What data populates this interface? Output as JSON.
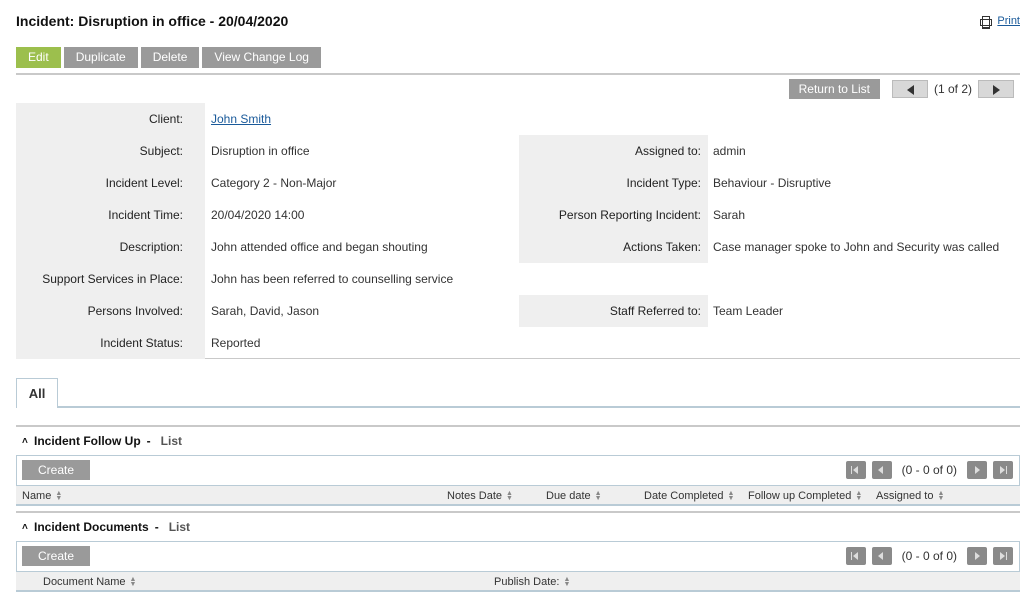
{
  "page": {
    "title": "Incident: Disruption in office - 20/04/2020",
    "print_label": "Print"
  },
  "actions": [
    "Edit",
    "Duplicate",
    "Delete",
    "View Change Log"
  ],
  "nav": {
    "return_label": "Return to List",
    "pager": "(1 of 2)"
  },
  "details": {
    "client": {
      "label": "Client:",
      "value": "John Smith"
    },
    "subject": {
      "label": "Subject:",
      "value": "Disruption in office"
    },
    "incident_level": {
      "label": "Incident Level:",
      "value": "Category 2 - Non-Major"
    },
    "incident_time": {
      "label": "Incident Time:",
      "value": "20/04/2020 14:00"
    },
    "description": {
      "label": "Description:",
      "value": "John attended office and began shouting"
    },
    "support_services": {
      "label": "Support Services in Place:",
      "value": "John has been referred to counselling service"
    },
    "persons_involved": {
      "label": "Persons Involved:",
      "value": "Sarah, David, Jason"
    },
    "incident_status": {
      "label": "Incident Status:",
      "value": "Reported"
    },
    "assigned_to": {
      "label": "Assigned to:",
      "value": "admin"
    },
    "incident_type": {
      "label": "Incident Type:",
      "value": "Behaviour - Disruptive"
    },
    "person_reporting": {
      "label": "Person Reporting Incident:",
      "value": "Sarah"
    },
    "actions_taken": {
      "label": "Actions Taken:",
      "value": "Case manager spoke to John and Security was called"
    },
    "staff_referred": {
      "label": "Staff Referred to:",
      "value": "Team Leader"
    }
  },
  "tabs": [
    "All"
  ],
  "follow_up": {
    "title": "Incident Follow Up",
    "sep": "-",
    "list_label": "List",
    "create_label": "Create",
    "pager": "(0 - 0 of 0)",
    "columns": [
      "Name",
      "Notes Date",
      "Due date",
      "Date Completed",
      "Follow up Completed",
      "Assigned to"
    ]
  },
  "documents": {
    "title": "Incident Documents",
    "sep": "-",
    "list_label": "List",
    "create_label": "Create",
    "pager": "(0 - 0 of 0)",
    "columns": [
      "Document Name",
      "Publish Date:"
    ]
  }
}
